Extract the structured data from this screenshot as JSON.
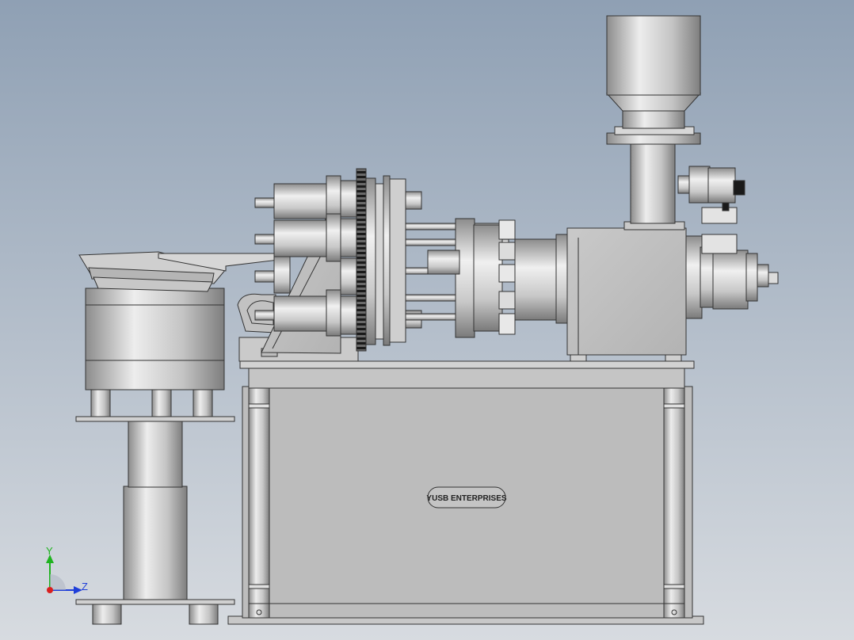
{
  "viewport": {
    "background_top": "#8fa0b4",
    "background_bottom": "#d7dbe0"
  },
  "nameplate": {
    "text": "YUSB ENTERPRISES"
  },
  "triad": {
    "y_label": "Y",
    "z_label": "Z",
    "y_color": "#1fb31f",
    "z_color": "#1f3fd9",
    "origin_color": "#d91f1f"
  },
  "colors": {
    "metal_light": "#e6e6e6",
    "metal_mid": "#b8b8b8",
    "metal_dark": "#7a7a7a",
    "outline": "#333333",
    "cabinet": "#bdbdbd"
  }
}
